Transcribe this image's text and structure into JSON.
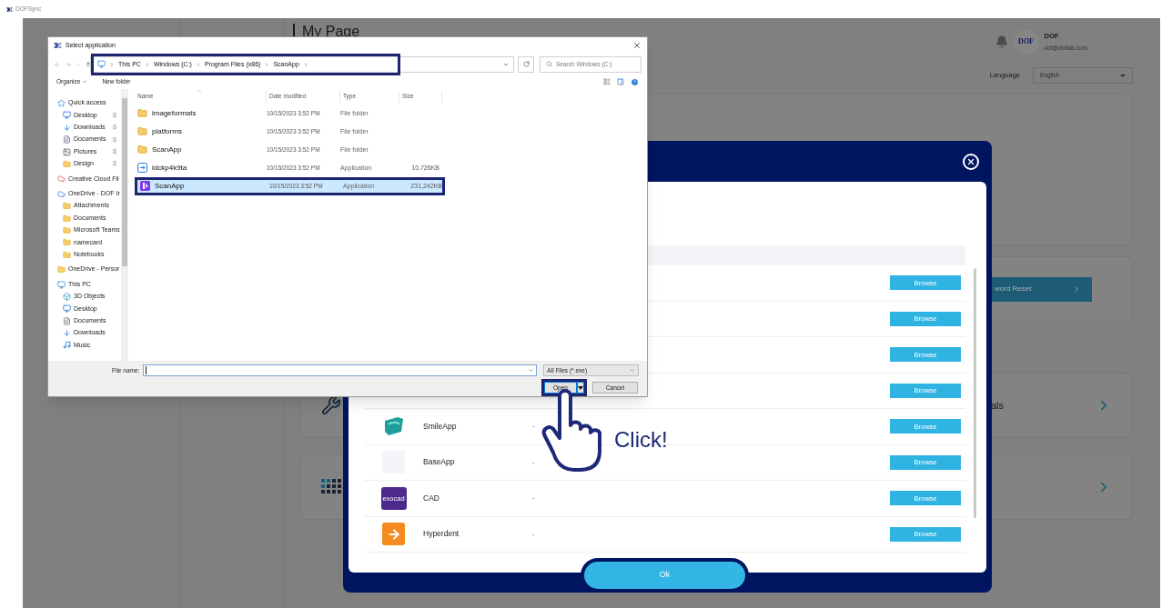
{
  "app": {
    "title": "DOFSync"
  },
  "page": {
    "heading": "My Page",
    "user": {
      "avatar_text": "DOF",
      "name": "DOF",
      "email": "dof@doflab.com"
    },
    "language": {
      "label": "Language",
      "value": "English"
    },
    "cards": [
      {
        "kind": "blank"
      },
      {
        "kind": "action",
        "button": "word Reset"
      },
      {
        "kind": "tools",
        "title": "als"
      },
      {
        "kind": "grid"
      }
    ]
  },
  "modal": {
    "rows": [
      {
        "kind": "hidden",
        "button": "Browse"
      },
      {
        "kind": "hidden",
        "button": "Browse"
      },
      {
        "kind": "hidden",
        "button": "Browse"
      },
      {
        "kind": "hidden",
        "button": "Browse"
      },
      {
        "kind": "smile",
        "name": "SmileApp",
        "path": "-",
        "button": "Browse"
      },
      {
        "kind": "blank",
        "name": "BaseApp",
        "path": "-",
        "button": "Browse"
      },
      {
        "kind": "label",
        "icon_text": "exocad",
        "name": "CAD",
        "path": "-",
        "button": "Browse"
      },
      {
        "kind": "arrow",
        "name": "Hyperdent",
        "path": "-",
        "button": "Browse"
      }
    ],
    "ok": "Ok"
  },
  "file_dialog": {
    "title": "Select application",
    "address": {
      "path": [
        "This PC",
        "Windows (C:)",
        "Program Files (x86)",
        "ScanApp"
      ],
      "highlighted": true
    },
    "search": {
      "placeholder": "Search Windows (C:)"
    },
    "toolbar": {
      "organize": "Organize",
      "new_folder": "New folder"
    },
    "nav": [
      {
        "label": "Quick access",
        "kind": "star",
        "children": [
          {
            "label": "Desktop",
            "kind": "desktop",
            "pinned": true
          },
          {
            "label": "Downloads",
            "kind": "download",
            "pinned": true
          },
          {
            "label": "Documents",
            "kind": "document",
            "pinned": true
          },
          {
            "label": "Pictures",
            "kind": "picture",
            "pinned": true
          },
          {
            "label": "Design",
            "kind": "folder",
            "pinned": true
          }
        ]
      },
      {
        "label": "Creative Cloud Fil",
        "kind": "cc"
      },
      {
        "label": "OneDrive - DOF Ir",
        "kind": "cloud",
        "children": [
          {
            "label": "Attachments",
            "kind": "folder"
          },
          {
            "label": "Documents",
            "kind": "folder"
          },
          {
            "label": "Microsoft Teams",
            "kind": "folder"
          },
          {
            "label": "namecard",
            "kind": "folder"
          },
          {
            "label": "Notebooks",
            "kind": "folder"
          }
        ]
      },
      {
        "label": "OneDrive - Persor",
        "kind": "folder"
      },
      {
        "label": "This PC",
        "kind": "pc",
        "children": [
          {
            "label": "3D Objects",
            "kind": "cube"
          },
          {
            "label": "Desktop",
            "kind": "desktop"
          },
          {
            "label": "Documents",
            "kind": "document"
          },
          {
            "label": "Downloads",
            "kind": "download"
          },
          {
            "label": "Music",
            "kind": "music"
          }
        ]
      }
    ],
    "columns": [
      "Name",
      "Date modified",
      "Type",
      "Size"
    ],
    "files": [
      {
        "kind": "folder",
        "name": "imageformats",
        "date": "10/15/2023 3:52 PM",
        "type": "File folder",
        "selected": false,
        "highlighted": false
      },
      {
        "kind": "folder",
        "name": "platforms",
        "date": "10/15/2023 3:52 PM",
        "type": "File folder",
        "selected": false,
        "highlighted": false
      },
      {
        "kind": "folder",
        "name": "ScanApp",
        "date": "10/15/2023 3:52 PM",
        "type": "File folder",
        "selected": false,
        "highlighted": false
      },
      {
        "kind": "app",
        "name": "idckp4k9ta",
        "date": "10/15/2023 3:52 PM",
        "type": "Application",
        "size": "10,726KB",
        "selected": false,
        "highlighted": false
      },
      {
        "kind": "scan",
        "name": "ScanApp",
        "date": "10/15/2023 3:52 PM",
        "type": "Application",
        "size": "231,242KB",
        "selected": true,
        "highlighted": true
      }
    ],
    "file_name_label": "File name:",
    "filter": "All Files (*.exe)",
    "open": {
      "label": "Open",
      "highlighted": true
    },
    "cancel": "Cancel"
  },
  "annotation": {
    "text": "Click!"
  }
}
